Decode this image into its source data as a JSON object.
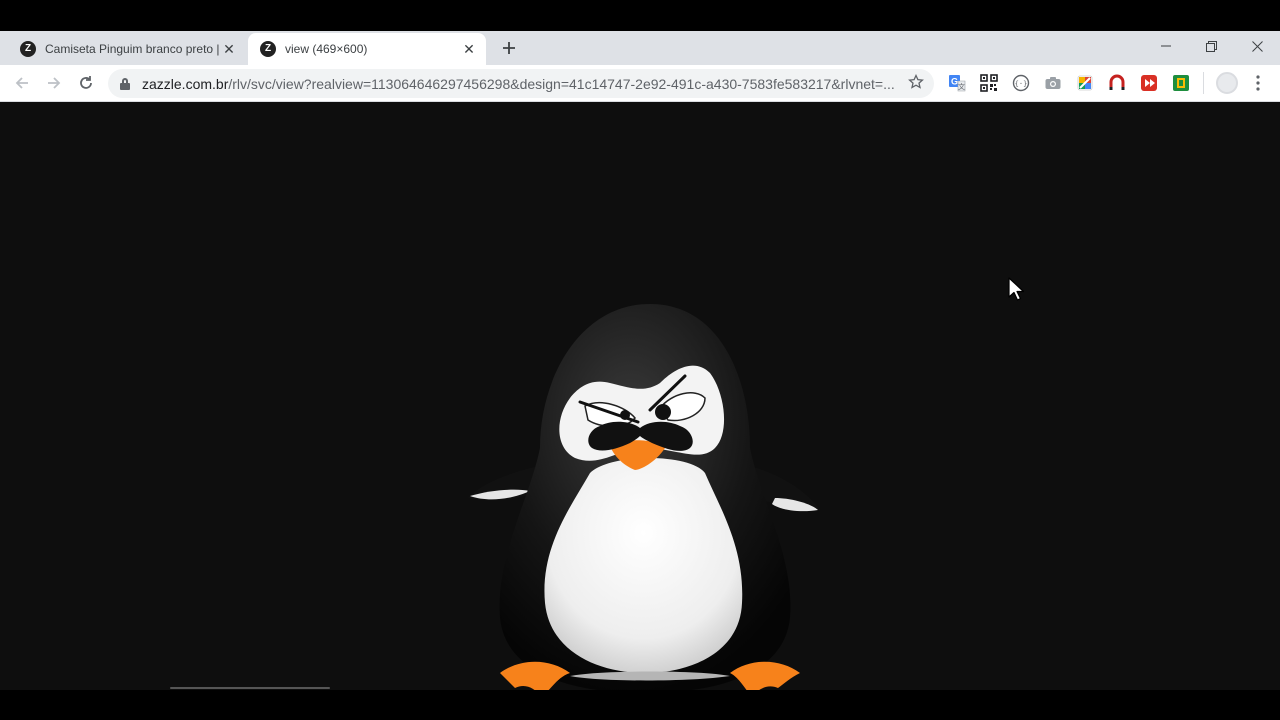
{
  "browser": {
    "tabs": [
      {
        "title": "Camiseta Pinguim branco preto |",
        "favicon": "zazzle-logo",
        "active": false
      },
      {
        "title": "view (469×600)",
        "favicon": "zazzle-logo",
        "active": true
      }
    ],
    "new_tab_icon": "plus-icon",
    "window_controls": [
      "minimize-icon",
      "restore-icon",
      "close-icon"
    ],
    "toolbar": {
      "back_icon": "arrow-left-icon",
      "forward_icon": "arrow-right-icon",
      "reload_icon": "reload-icon",
      "url_host": "zazzle.com.br",
      "url_path": "/rlv/svc/view?realview=113064646297456298&design=41c14747-2e92-491c-a430-7583fe583217&rlvnet=...",
      "bookmark_icon": "star-icon"
    },
    "extensions": [
      "google-translate-icon",
      "qr-code-icon",
      "code-icon",
      "camera-icon",
      "colorzilla-icon",
      "magnet-icon",
      "media-icon",
      "green-extension-icon"
    ],
    "profile_icon": "profile-avatar-icon",
    "menu_icon": "more-vert-icon"
  },
  "content": {
    "image_alt": "penguin with mustache",
    "image_icon": "penguin-illustration"
  },
  "colors": {
    "tabstrip": "#dee1e6",
    "viewport_bg": "#0e0e0e",
    "beak_feet": "#f7821b"
  }
}
